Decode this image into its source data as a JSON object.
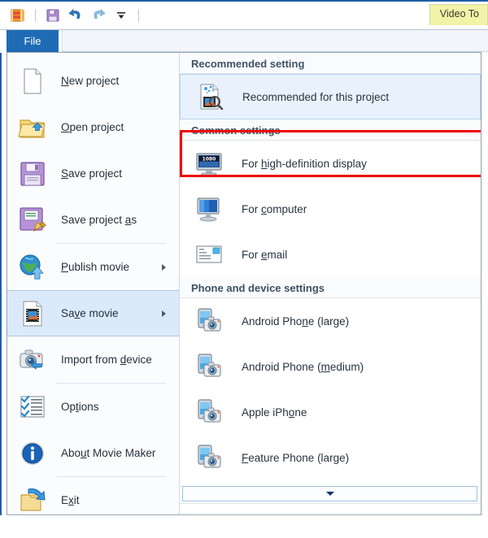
{
  "window": {
    "quick_access_icons": [
      "movie-maker-logo-icon",
      "save-icon",
      "undo-icon",
      "redo-icon",
      "customize-dropdown-icon"
    ],
    "context_tab_label": "Video To",
    "file_tab_label": "File"
  },
  "menu": {
    "items": [
      {
        "label_pre": "",
        "label_accel": "N",
        "label_post": "ew project",
        "icon": "new-document-icon",
        "name": "new-project",
        "arrow": false,
        "highlighted": false,
        "sep_after": false
      },
      {
        "label_pre": "",
        "label_accel": "O",
        "label_post": "pen project",
        "icon": "open-folder-icon",
        "name": "open-project",
        "arrow": false,
        "highlighted": false,
        "sep_after": false
      },
      {
        "label_pre": "",
        "label_accel": "S",
        "label_post": "ave project",
        "icon": "floppy-save-icon",
        "name": "save-project",
        "arrow": false,
        "highlighted": false,
        "sep_after": false
      },
      {
        "label_pre": "Save project ",
        "label_accel": "a",
        "label_post": "s",
        "icon": "floppy-save-as-icon",
        "name": "save-project-as",
        "arrow": false,
        "highlighted": false,
        "sep_after": true
      },
      {
        "label_pre": "",
        "label_accel": "P",
        "label_post": "ublish movie",
        "icon": "globe-publish-icon",
        "name": "publish-movie",
        "arrow": true,
        "highlighted": false,
        "sep_after": false
      },
      {
        "label_pre": "Sa",
        "label_accel": "v",
        "label_post": "e movie",
        "icon": "film-save-icon",
        "name": "save-movie",
        "arrow": true,
        "highlighted": true,
        "sep_after": false
      },
      {
        "label_pre": "Import from ",
        "label_accel": "d",
        "label_post": "evice",
        "icon": "camera-import-icon",
        "name": "import-from-device",
        "arrow": false,
        "highlighted": false,
        "sep_after": true
      },
      {
        "label_pre": "Op",
        "label_accel": "t",
        "label_post": "ions",
        "icon": "options-checklist-icon",
        "name": "options",
        "arrow": false,
        "highlighted": false,
        "sep_after": false
      },
      {
        "label_pre": "Abo",
        "label_accel": "u",
        "label_post": "t Movie Maker",
        "icon": "info-circle-icon",
        "name": "about-movie-maker",
        "arrow": false,
        "highlighted": false,
        "sep_after": true
      },
      {
        "label_pre": "E",
        "label_accel": "x",
        "label_post": "it",
        "icon": "exit-folder-arrow-icon",
        "name": "exit",
        "arrow": false,
        "highlighted": false,
        "sep_after": false
      }
    ]
  },
  "save_movie_panel": {
    "sections": [
      {
        "name": "recommended-setting",
        "header": "Recommended setting",
        "options": [
          {
            "label_pre": "Recommended for this pro",
            "label_accel": "j",
            "label_post": "ect",
            "icon": "recommended-project-icon",
            "name": "recommended-for-this-project",
            "selected": true
          }
        ]
      },
      {
        "name": "common-settings",
        "header": "Common settings",
        "options": [
          {
            "label_pre": "For ",
            "label_accel": "h",
            "label_post": "igh-definition display",
            "icon": "hd-monitor-1080-icon",
            "name": "for-high-definition-display",
            "selected": false
          },
          {
            "label_pre": "For ",
            "label_accel": "c",
            "label_post": "omputer",
            "icon": "computer-monitor-icon",
            "name": "for-computer",
            "selected": false
          },
          {
            "label_pre": "For ",
            "label_accel": "e",
            "label_post": "mail",
            "icon": "email-envelope-icon",
            "name": "for-email",
            "selected": false
          }
        ]
      },
      {
        "name": "phone-and-device-settings",
        "header": "Phone and device settings",
        "options": [
          {
            "label_pre": "Android Pho",
            "label_accel": "n",
            "label_post": "e (large)",
            "icon": "phone-camera-icon",
            "name": "android-phone-large",
            "selected": false
          },
          {
            "label_pre": "Android Phone (",
            "label_accel": "m",
            "label_post": "edium)",
            "icon": "phone-camera-icon",
            "name": "android-phone-medium",
            "selected": false
          },
          {
            "label_pre": "Apple iPh",
            "label_accel": "o",
            "label_post": "ne",
            "icon": "phone-camera-icon",
            "name": "apple-iphone",
            "selected": false
          },
          {
            "label_pre": "",
            "label_accel": "F",
            "label_post": "eature Phone (large)",
            "icon": "phone-camera-icon",
            "name": "feature-phone-large",
            "selected": false
          }
        ]
      }
    ],
    "scroll_down_label": ""
  }
}
